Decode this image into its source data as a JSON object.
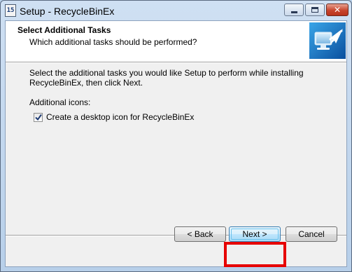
{
  "window": {
    "title": "Setup - RecycleBinEx",
    "controls": {
      "minimize_icon": "minimize-icon",
      "maximize_icon": "maximize-icon",
      "close_label": "✕"
    }
  },
  "header": {
    "title": "Select Additional Tasks",
    "subtitle": "Which additional tasks should be performed?",
    "image_icon": "monitor-arrow-icon"
  },
  "body": {
    "instructions": "Select the additional tasks you would like Setup to perform while installing RecycleBinEx, then click Next.",
    "group_label": "Additional icons:",
    "tasks": [
      {
        "label": "Create a desktop icon for RecycleBinEx",
        "checked": true
      }
    ]
  },
  "buttons": {
    "back": "< Back",
    "next": "Next >",
    "cancel": "Cancel"
  },
  "colors": {
    "highlight": "#e60000",
    "title_bar": "#b9d1ea",
    "close_button": "#c8452d"
  }
}
